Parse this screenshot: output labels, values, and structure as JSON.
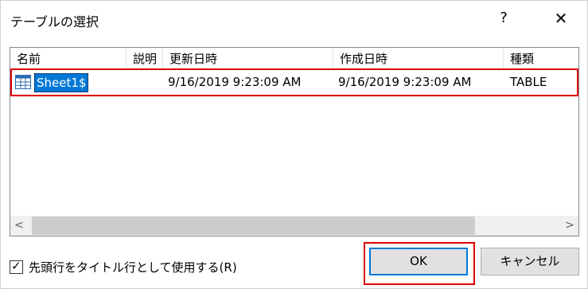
{
  "dialog": {
    "title": "テーブルの選択",
    "help_label": "?",
    "close_label": "✕"
  },
  "columns": {
    "name": "名前",
    "description": "説明",
    "modified": "更新日時",
    "created": "作成日時",
    "type": "種類"
  },
  "rows": [
    {
      "name": "Sheet1$",
      "description": "",
      "modified": "9/16/2019 9:23:09 AM",
      "created": "9/16/2019 9:23:09 AM",
      "type": "TABLE",
      "icon": "table-icon"
    }
  ],
  "scrollbar": {
    "left_arrow": "<",
    "right_arrow": ">"
  },
  "options": {
    "first_row_header_label": "先頭行をタイトル行として使用する(R)",
    "first_row_header_checked": true,
    "checkmark": "✓"
  },
  "buttons": {
    "ok": "OK",
    "cancel": "キャンセル"
  },
  "colors": {
    "selection": "#0078d7",
    "highlight_box": "#e00000",
    "button_face": "#e1e1e1"
  }
}
